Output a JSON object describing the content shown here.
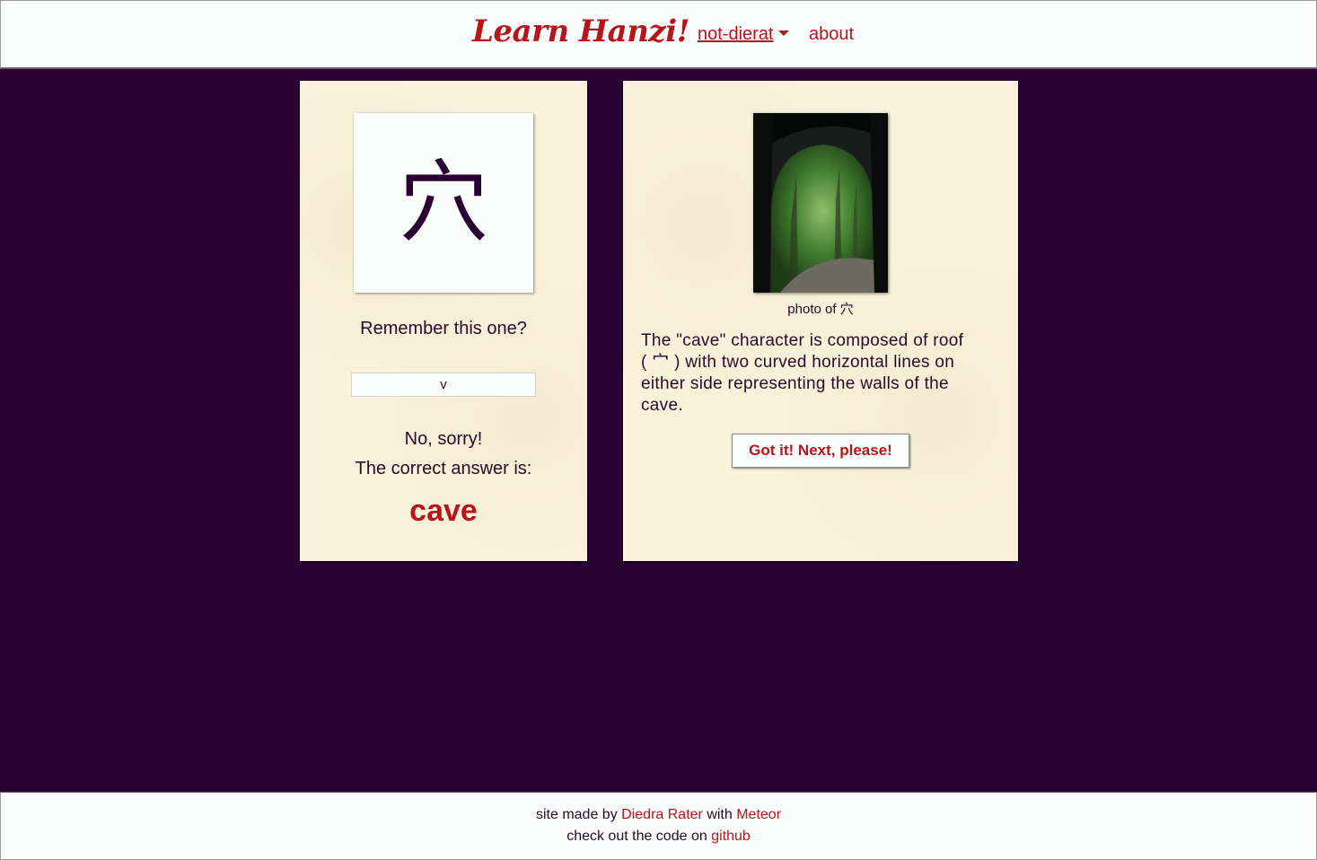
{
  "header": {
    "logo": "Learn Hanzi!",
    "user_menu": "not-dierat",
    "about": "about"
  },
  "quiz": {
    "character": "穴",
    "prompt": "Remember this one?",
    "answer_value": "v",
    "feedback": "No, sorry!",
    "correct_label": "The correct answer is:",
    "correct_answer": "cave"
  },
  "info": {
    "caption": "photo of 穴",
    "description_lines": [
      "The \"cave\" character is composed of roof",
      "( 宀 ) with two curved horizontal lines on",
      "either side representing the walls of the",
      "cave."
    ],
    "next_button": "Got it! Next, please!"
  },
  "footer": {
    "made_by_prefix": "site made by",
    "author": "Diedra Rater",
    "with": "with",
    "framework": "Meteor",
    "code_prefix": "check out the code on",
    "code_link": "github"
  },
  "colors": {
    "background": "#2a0033",
    "accent": "#b5161b",
    "card": "#faf2dc"
  }
}
